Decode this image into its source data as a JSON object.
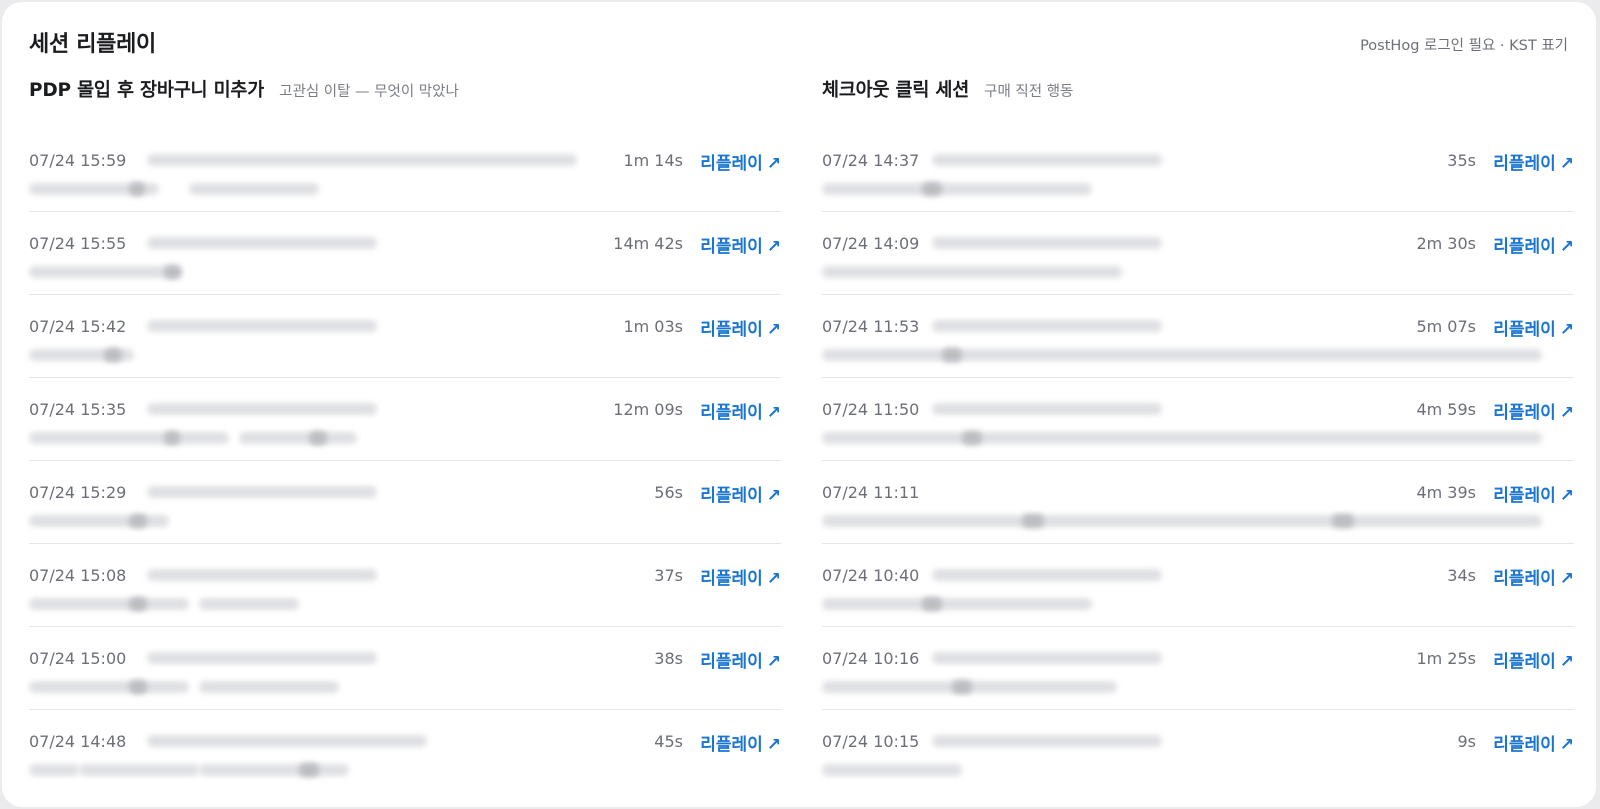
{
  "header": {
    "title": "세션 리플레이",
    "note": "PostHog 로그인 필요 · KST 표기"
  },
  "left": {
    "title": "PDP 몰입 후 장바구니 미추가",
    "subtitle": "고관심 이탈 — 무엇이 막았나",
    "rows": [
      {
        "time": "07/24 15:59",
        "duration": "1m 14s",
        "replay": "리플레이"
      },
      {
        "time": "07/24 15:55",
        "duration": "14m 42s",
        "replay": "리플레이"
      },
      {
        "time": "07/24 15:42",
        "duration": "1m 03s",
        "replay": "리플레이"
      },
      {
        "time": "07/24 15:35",
        "duration": "12m 09s",
        "replay": "리플레이"
      },
      {
        "time": "07/24 15:29",
        "duration": "56s",
        "replay": "리플레이"
      },
      {
        "time": "07/24 15:08",
        "duration": "37s",
        "replay": "리플레이"
      },
      {
        "time": "07/24 15:00",
        "duration": "38s",
        "replay": "리플레이"
      },
      {
        "time": "07/24 14:48",
        "duration": "45s",
        "replay": "리플레이"
      }
    ]
  },
  "right": {
    "title": "체크아웃 클릭 세션",
    "subtitle": "구매 직전 행동",
    "rows": [
      {
        "time": "07/24 14:37",
        "duration": "35s",
        "replay": "리플레이"
      },
      {
        "time": "07/24 14:09",
        "duration": "2m 30s",
        "replay": "리플레이"
      },
      {
        "time": "07/24 11:53",
        "duration": "5m 07s",
        "replay": "리플레이"
      },
      {
        "time": "07/24 11:50",
        "duration": "4m 59s",
        "replay": "리플레이"
      },
      {
        "time": "07/24 11:11",
        "duration": "4m 39s",
        "replay": "리플레이"
      },
      {
        "time": "07/24 10:40",
        "duration": "34s",
        "replay": "리플레이"
      },
      {
        "time": "07/24 10:16",
        "duration": "1m 25s",
        "replay": "리플레이"
      },
      {
        "time": "07/24 10:15",
        "duration": "9s",
        "replay": "리플레이"
      }
    ]
  },
  "icons": {
    "external_link": "arrow-up-right-icon"
  },
  "colors": {
    "accent": "#1a75d2",
    "muted": "#6c6f76",
    "title": "#1b1c1f",
    "divider": "#e4e5e8"
  }
}
